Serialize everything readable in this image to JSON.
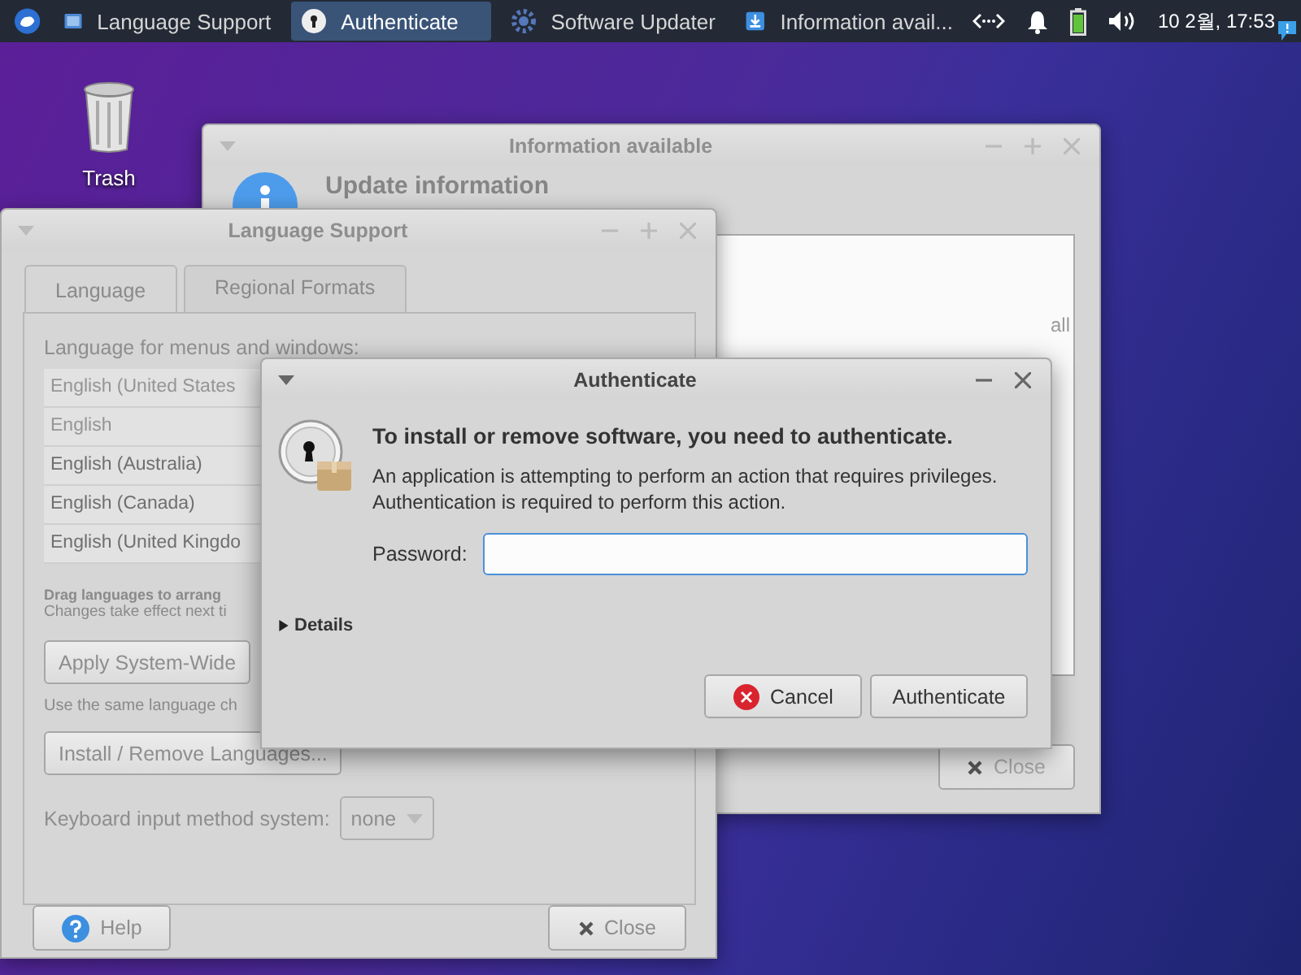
{
  "taskbar": {
    "tasks": [
      {
        "label": "Language Support",
        "selected": false
      },
      {
        "label": "Authenticate",
        "selected": true
      },
      {
        "label": "Software Updater",
        "selected": false
      },
      {
        "label": "Information avail...",
        "selected": false
      }
    ],
    "clock": "10 2월, 17:53"
  },
  "desktop_icons": [
    {
      "label": "Trash"
    }
  ],
  "info_window": {
    "title": "Information available",
    "active": false,
    "heading": "Update information",
    "text_fragment": "all",
    "close_button": "Close"
  },
  "language_window": {
    "title": "Language Support",
    "active": false,
    "disabled": true,
    "tabs": [
      {
        "label": "Language",
        "selected": true
      },
      {
        "label": "Regional Formats",
        "selected": false
      }
    ],
    "list_label": "Language for menus and windows:",
    "languages": [
      {
        "name": "English (United States",
        "dimmed": true
      },
      {
        "name": "English",
        "dimmed": true
      },
      {
        "name": "English (Australia)",
        "dimmed": false
      },
      {
        "name": "English (Canada)",
        "dimmed": false
      },
      {
        "name": "English (United Kingdo",
        "dimmed": false
      }
    ],
    "drag_hint": "Drag languages to arrang",
    "changes_hint": "Changes take effect next ti",
    "apply_button": "Apply System-Wide",
    "same_language_hint": "Use the same language ch",
    "install_button": "Install / Remove Languages...",
    "input_method_label": "Keyboard input method system:",
    "input_method_value": "none",
    "help_button": "Help",
    "close_button": "Close"
  },
  "auth_dialog": {
    "title": "Authenticate",
    "active": true,
    "heading": "To install or remove software, you need to authenticate.",
    "message_lines": [
      "An application is attempting to perform an action that requires privileges.",
      "Authentication is required to perform this action."
    ],
    "password_label": "Password:",
    "details": "Details",
    "details_expanded": false,
    "cancel_button": "Cancel",
    "authenticate_button": "Authenticate"
  }
}
